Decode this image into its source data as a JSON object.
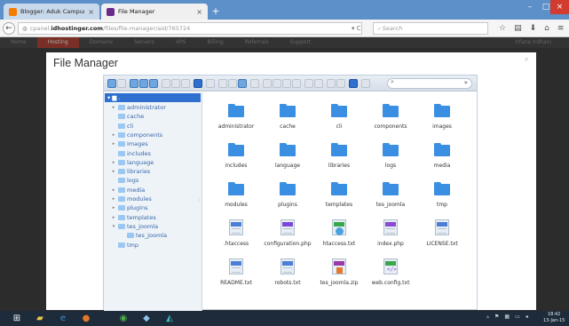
{
  "browser": {
    "tabs": [
      {
        "title": "Blogger: Aduk Campur Ad...",
        "active": false,
        "favicon_color": "#f57c00"
      },
      {
        "title": "File Manager",
        "active": true,
        "favicon_color": "#6a2a8a"
      }
    ],
    "url": {
      "prefix": "cpanel.",
      "host": "idhostinger.com",
      "path": "/files/file-manager/aid/765724"
    },
    "search_placeholder": "Search"
  },
  "hosting_menu": {
    "items": [
      "Home",
      "Hosting",
      "Domains",
      "Servers",
      "VPS",
      "Billing",
      "Referrals",
      "Support"
    ],
    "active": "Hosting",
    "user": "Irfane Irdhani"
  },
  "modal": {
    "title": "File Manager",
    "close_label": "×"
  },
  "file_manager": {
    "tree_root": ".",
    "tree": [
      {
        "name": "administrator",
        "has_children": true,
        "level": 1
      },
      {
        "name": "cache",
        "has_children": false,
        "level": 1
      },
      {
        "name": "cli",
        "has_children": false,
        "level": 1
      },
      {
        "name": "components",
        "has_children": true,
        "level": 1
      },
      {
        "name": "images",
        "has_children": true,
        "level": 1
      },
      {
        "name": "includes",
        "has_children": false,
        "level": 1
      },
      {
        "name": "language",
        "has_children": true,
        "level": 1
      },
      {
        "name": "libraries",
        "has_children": true,
        "level": 1
      },
      {
        "name": "logs",
        "has_children": false,
        "level": 1
      },
      {
        "name": "media",
        "has_children": true,
        "level": 1
      },
      {
        "name": "modules",
        "has_children": true,
        "level": 1
      },
      {
        "name": "plugins",
        "has_children": true,
        "level": 1
      },
      {
        "name": "templates",
        "has_children": true,
        "level": 1
      },
      {
        "name": "tes_joomla",
        "has_children": true,
        "expanded": true,
        "level": 1
      },
      {
        "name": "tes_joomla",
        "has_children": false,
        "level": 2
      },
      {
        "name": "tmp",
        "has_children": false,
        "level": 1
      }
    ],
    "items": [
      {
        "name": "administrator",
        "kind": "folder"
      },
      {
        "name": "cache",
        "kind": "folder"
      },
      {
        "name": "cli",
        "kind": "folder"
      },
      {
        "name": "components",
        "kind": "folder"
      },
      {
        "name": "images",
        "kind": "folder"
      },
      {
        "name": "includes",
        "kind": "folder"
      },
      {
        "name": "language",
        "kind": "folder"
      },
      {
        "name": "libraries",
        "kind": "folder"
      },
      {
        "name": "logs",
        "kind": "folder"
      },
      {
        "name": "media",
        "kind": "folder"
      },
      {
        "name": "modules",
        "kind": "folder"
      },
      {
        "name": "plugins",
        "kind": "folder"
      },
      {
        "name": "templates",
        "kind": "folder"
      },
      {
        "name": "tes_joomla",
        "kind": "folder"
      },
      {
        "name": "tmp",
        "kind": "folder"
      },
      {
        "name": ".htaccess",
        "kind": "doc",
        "band_color": "#4a7fd6"
      },
      {
        "name": "configuration.php",
        "kind": "doc",
        "band_color": "#7a4ad6"
      },
      {
        "name": "htaccess.txt",
        "kind": "round",
        "band_color": "#3aa84a"
      },
      {
        "name": "index.php",
        "kind": "doc",
        "band_color": "#8a4ad6"
      },
      {
        "name": "LICENSE.txt",
        "kind": "doc",
        "band_color": "#4a7fd6"
      },
      {
        "name": "README.txt",
        "kind": "doc",
        "band_color": "#4a7fd6"
      },
      {
        "name": "robots.txt",
        "kind": "doc",
        "band_color": "#4a7fd6"
      },
      {
        "name": "tes_joomla.zip",
        "kind": "zip",
        "band_color": "#9a3aa8"
      },
      {
        "name": "web.config.txt",
        "kind": "code",
        "band_color": "#3aa84a"
      }
    ]
  },
  "taskbar": {
    "time": "18:42",
    "date": "13-Jan-15"
  },
  "colors": {
    "tabbar": "#5d8fc9",
    "folder": "#3a8fe2",
    "tree_select": "#2e6fcf",
    "taskbar": "#1d2b3a"
  }
}
